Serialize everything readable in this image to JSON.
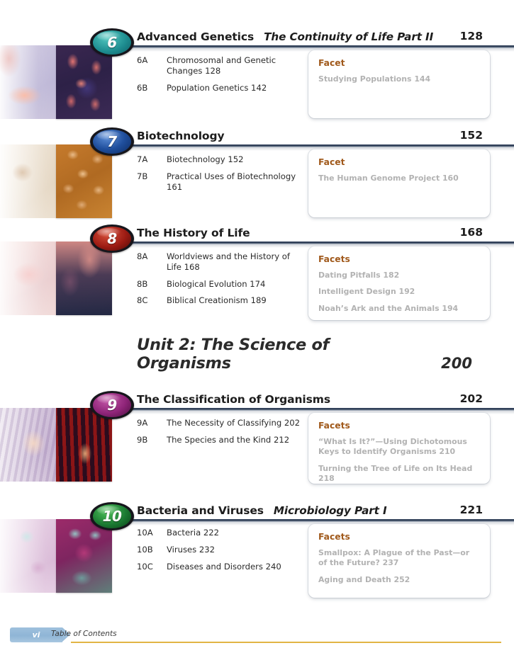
{
  "page": {
    "footer": {
      "page_number": "vi",
      "label": "Table of Contents"
    }
  },
  "chapters": [
    {
      "number": "6",
      "title": "Advanced Genetics",
      "subtitle": "The Continuity of Life Part II",
      "page": "128",
      "bubble_color": "#1f8f92",
      "sections": [
        {
          "id": "6A",
          "text": "Chromosomal and Genetic Changes 128"
        },
        {
          "id": "6B",
          "text": "Population Genetics 142"
        }
      ],
      "facet": {
        "heading": "Facet",
        "items": [
          "Studying Populations 144"
        ]
      }
    },
    {
      "number": "7",
      "title": "Biotechnology",
      "subtitle": "",
      "page": "152",
      "bubble_color": "#1f4e9c",
      "sections": [
        {
          "id": "7A",
          "text": "Biotechnology 152"
        },
        {
          "id": "7B",
          "text": "Practical Uses of Biotechnology 161"
        }
      ],
      "facet": {
        "heading": "Facet",
        "items": [
          "The Human Genome Project 160"
        ]
      }
    },
    {
      "number": "8",
      "title": "The History of Life",
      "subtitle": "",
      "page": "168",
      "bubble_color": "#9c1b13",
      "sections": [
        {
          "id": "8A",
          "text": "Worldviews and the History of Life 168"
        },
        {
          "id": "8B",
          "text": "Biological Evolution 174"
        },
        {
          "id": "8C",
          "text": "Biblical Creationism 189"
        }
      ],
      "facet": {
        "heading": "Facets",
        "items": [
          "Dating Pitfalls 182",
          "Intelligent Design 192",
          "Noah’s Ark and the Animals 194"
        ]
      }
    },
    {
      "number": "9",
      "title": "The Classification of Organisms",
      "subtitle": "",
      "page": "202",
      "bubble_color": "#8e2478",
      "sections": [
        {
          "id": "9A",
          "text": "The Necessity of Classifying 202"
        },
        {
          "id": "9B",
          "text": "The Species and the Kind 212"
        }
      ],
      "facet": {
        "heading": "Facets",
        "items": [
          "“What Is It?”—Using Dichotomous Keys to Identify Organisms 210",
          "Turning the Tree of Life on Its Head 218"
        ]
      }
    },
    {
      "number": "10",
      "title": "Bacteria and Viruses",
      "subtitle": "Microbiology Part I",
      "page": "221",
      "bubble_color": "#1b7a32",
      "sections": [
        {
          "id": "10A",
          "text": "Bacteria 222"
        },
        {
          "id": "10B",
          "text": "Viruses 232"
        },
        {
          "id": "10C",
          "text": "Diseases and Disorders 240"
        }
      ],
      "facet": {
        "heading": "Facets",
        "items": [
          "Smallpox: A Plague of the Past—or of the Future? 237",
          "Aging and Death 252"
        ]
      }
    }
  ],
  "unit": {
    "title": "Unit 2: The Science of Organisms",
    "page": "200"
  }
}
